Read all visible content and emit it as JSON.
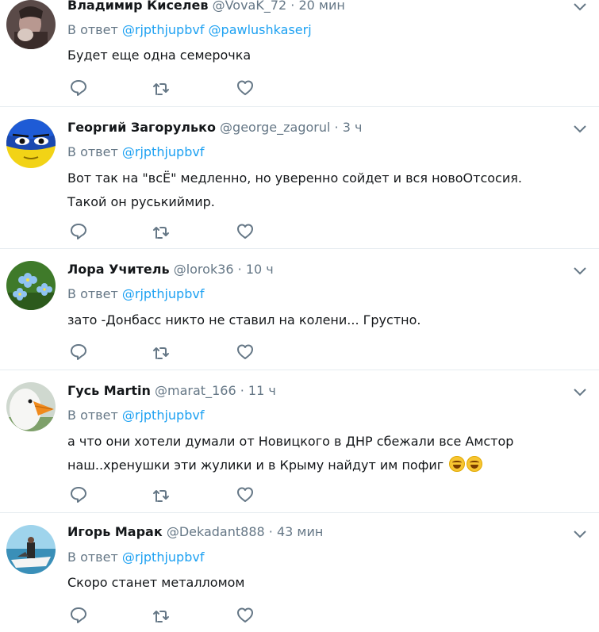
{
  "colors": {
    "text": "#14171a",
    "muted": "#657786",
    "link": "#1da1f2",
    "divider": "#e6ecf0"
  },
  "reply_prefix": "В ответ",
  "tweets": [
    {
      "name": "Владимир Киселев",
      "handle": "@VovaK_72",
      "sep": "·",
      "time": "20 мин",
      "mentions": [
        "@rjpthjupbvf",
        "@pawlushkaserj"
      ],
      "text_lines": [
        "Будет еще одна семерочка"
      ],
      "avatar": "person-photo"
    },
    {
      "name": "Георгий Загорулько",
      "handle": "@george_zagorul",
      "sep": "·",
      "time": "3 ч",
      "mentions": [
        "@rjpthjupbvf"
      ],
      "text_lines": [
        "Вот так на \"всЁ\" медленно, но уверенно сойдет и вся новоОтсосия.",
        "Такой он руськиймир."
      ],
      "avatar": "blue-yellow-face"
    },
    {
      "name": "Лора Учитель",
      "handle": "@lorok36",
      "sep": "·",
      "time": "10 ч",
      "mentions": [
        "@rjpthjupbvf"
      ],
      "text_lines": [
        "зато -Донбасс никто не ставил на колени... Грустно."
      ],
      "avatar": "forget-me-not-flowers"
    },
    {
      "name": "Гусь Martin",
      "handle": "@marat_166",
      "sep": "·",
      "time": "11 ч",
      "mentions": [
        "@rjpthjupbvf"
      ],
      "text_lines": [
        "а что они хотели думали от Новицкого в ДНР сбежали все Амстор",
        "наш..хренушки эти жулики и в Крыму найдут им пофиг"
      ],
      "emojis": [
        "rolling-on-floor-laughing",
        "tears-of-joy"
      ],
      "avatar": "goose"
    },
    {
      "name": "Игорь Марак",
      "handle": "@Dekadant888",
      "sep": "·",
      "time": "43 мин",
      "mentions": [
        "@rjpthjupbvf"
      ],
      "text_lines": [
        "Скоро станет металломом"
      ],
      "avatar": "boat-photo"
    }
  ],
  "icons": {
    "reply": "reply-icon",
    "retweet": "retweet-icon",
    "like": "like-icon",
    "caret": "chevron-down-icon"
  }
}
